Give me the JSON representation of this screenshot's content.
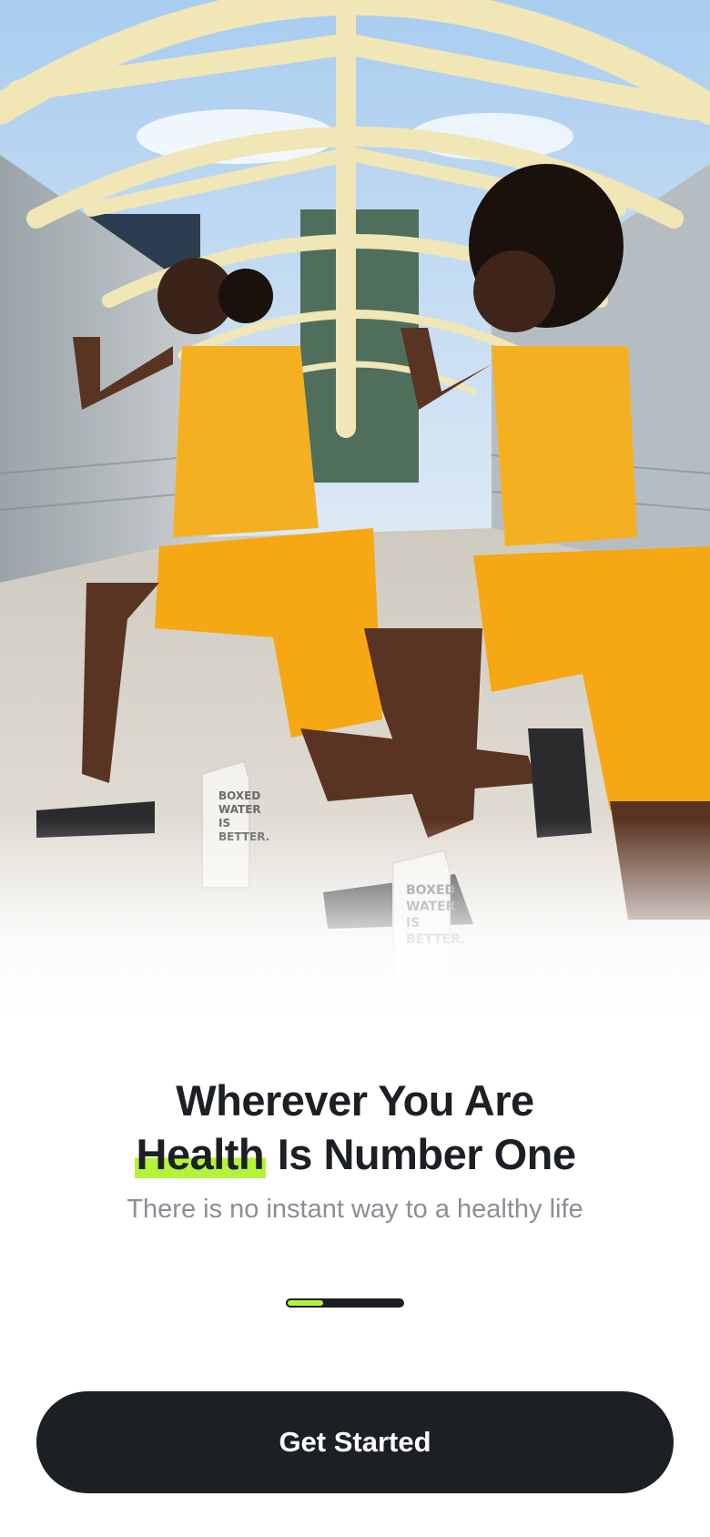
{
  "hero": {
    "image": "two-women-lunging-on-bridge-photo",
    "carton_text": "BOXED WATER IS BETTER."
  },
  "headline": {
    "line1": "Wherever You Are",
    "highlight": "Health",
    "line2_rest": " Is Number One"
  },
  "subtitle": "There is no instant way to a healthy life",
  "onboarding": {
    "current_page": 1,
    "total_pages": 3,
    "progress": 0.33
  },
  "cta": {
    "label": "Get Started"
  },
  "colors": {
    "accent": "#b5f33b",
    "primary": "#1c1f24",
    "muted": "#8a8f95"
  }
}
